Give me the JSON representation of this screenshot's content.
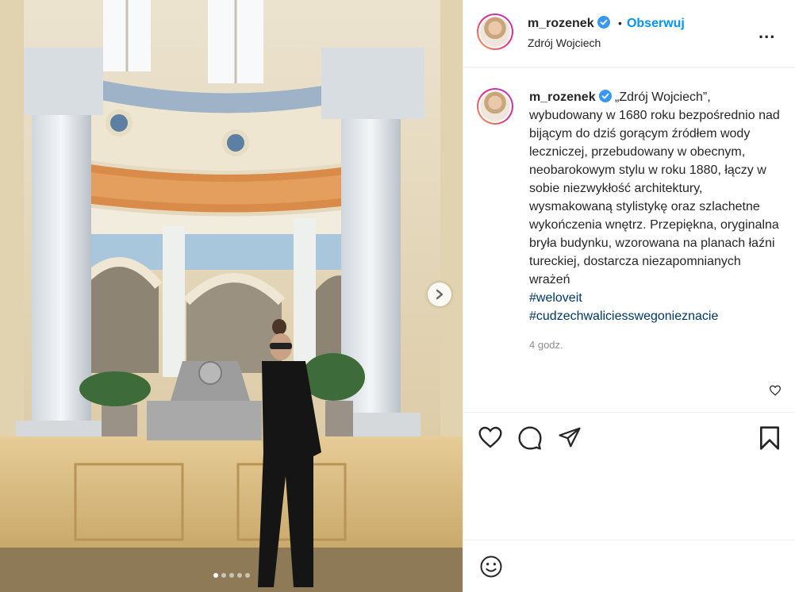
{
  "post": {
    "username": "m_rozenek",
    "follow_label": "Obserwuj",
    "separator": "•",
    "location": "Zdrój Wojciech",
    "more_label": "...",
    "caption_text": "„Zdrój Wojciech”, wybudowany w 1680 roku bezpośrednio nad bijącym do dziś gorącym źródłem wody leczniczej, przebudowany w obecnym, neobarokowym stylu w roku 1880, łączy w sobie niezwykłość architektury, wysmakowaną stylistykę oraz szlachetne wykończenia wnętrz. Przepiękna, oryginalna bryła budynku, wzorowana na planach łaźni tureckiej, dostarcza niezapomnianych wrażeń",
    "hashtags": [
      "#weloveit",
      "#cudzechwaliciesswegonieznacie"
    ],
    "timestamp": "4 godz.",
    "carousel": {
      "count": 5,
      "active_index": 0
    }
  },
  "icons": {
    "verified": "verified-badge-icon",
    "next": "chevron-right-icon",
    "like": "heart-icon",
    "comment": "comment-bubble-icon",
    "share": "paper-plane-icon",
    "save": "bookmark-icon",
    "emoji": "smiley-icon"
  },
  "colors": {
    "accent": "#0095f6",
    "hashtag": "#00376b",
    "muted": "#8e8e8e",
    "text": "#262626",
    "border": "#efefef"
  }
}
